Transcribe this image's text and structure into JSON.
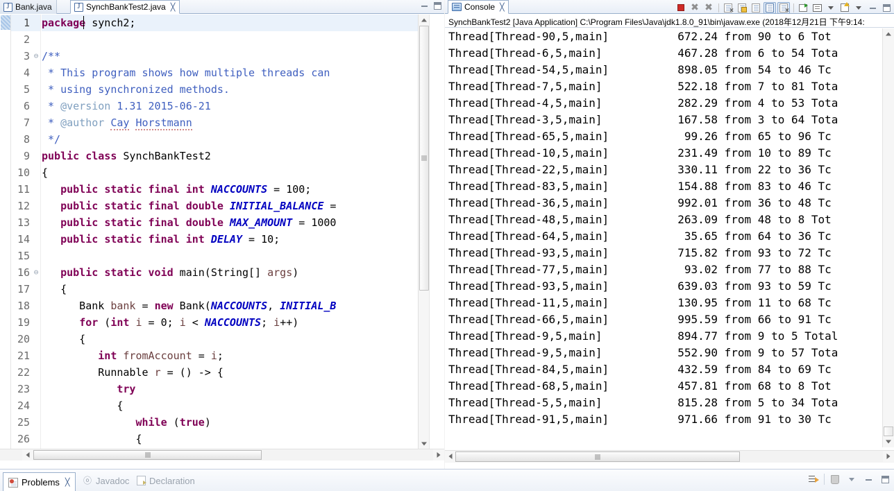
{
  "editor": {
    "tabs": [
      {
        "label": "Bank.java",
        "icon": "java-file-icon",
        "active": false,
        "closable": false
      },
      {
        "label": "SynchBankTest2.java",
        "icon": "java-file-icon",
        "active": true,
        "closable": true
      }
    ],
    "tab_minimize_label": "Minimize",
    "tab_maximize_label": "Maximize",
    "first_visible_line": 1,
    "lines": [
      {
        "n": "1",
        "fold": "",
        "html": "<span class=\"kw\">package</span> synch2;",
        "current": true
      },
      {
        "n": "2",
        "fold": "",
        "html": ""
      },
      {
        "n": "3",
        "fold": "⊖",
        "html": "<span class=\"cmt\">/**</span>"
      },
      {
        "n": "4",
        "fold": "",
        "html": "<span class=\"cmt\"> * This program shows how multiple threads can</span>"
      },
      {
        "n": "5",
        "fold": "",
        "html": "<span class=\"cmt\"> * using synchronized methods.</span>"
      },
      {
        "n": "6",
        "fold": "",
        "html": "<span class=\"cmt\"> * </span><span class=\"tag\">@version</span><span class=\"cmt\"> 1.31 2015-06-21</span>"
      },
      {
        "n": "7",
        "fold": "",
        "html": "<span class=\"cmt\"> * </span><span class=\"tag\">@author</span><span class=\"cmt\"> </span><span class=\"cmt sq\">Cay</span><span class=\"cmt\"> </span><span class=\"cmt sq\">Horstmann</span>"
      },
      {
        "n": "8",
        "fold": "",
        "html": "<span class=\"cmt\"> */</span>"
      },
      {
        "n": "9",
        "fold": "",
        "html": "<span class=\"kw\">public</span> <span class=\"kw\">class</span> SynchBankTest2"
      },
      {
        "n": "10",
        "fold": "",
        "html": "{"
      },
      {
        "n": "11",
        "fold": "",
        "html": "   <span class=\"kw\">public</span> <span class=\"kw\">static</span> <span class=\"kw\">final</span> <span class=\"kw\">int</span> <span class=\"field\">NACCOUNTS</span> = 100;"
      },
      {
        "n": "12",
        "fold": "",
        "html": "   <span class=\"kw\">public</span> <span class=\"kw\">static</span> <span class=\"kw\">final</span> <span class=\"kw\">double</span> <span class=\"field\">INITIAL_BALANCE</span> ="
      },
      {
        "n": "13",
        "fold": "",
        "html": "   <span class=\"kw\">public</span> <span class=\"kw\">static</span> <span class=\"kw\">final</span> <span class=\"kw\">double</span> <span class=\"field\">MAX_AMOUNT</span> = 1000"
      },
      {
        "n": "14",
        "fold": "",
        "html": "   <span class=\"kw\">public</span> <span class=\"kw\">static</span> <span class=\"kw\">final</span> <span class=\"kw\">int</span> <span class=\"field\">DELAY</span> = 10;"
      },
      {
        "n": "15",
        "fold": "",
        "html": ""
      },
      {
        "n": "16",
        "fold": "⊖",
        "html": "   <span class=\"kw\">public</span> <span class=\"kw\">static</span> <span class=\"kw\">void</span> main(String[] <span class=\"local\">args</span>)"
      },
      {
        "n": "17",
        "fold": "",
        "html": "   {"
      },
      {
        "n": "18",
        "fold": "",
        "html": "      Bank <span class=\"local\">bank</span> = <span class=\"kw\">new</span> Bank(<span class=\"field\">NACCOUNTS</span>, <span class=\"field\">INITIAL_B</span>"
      },
      {
        "n": "19",
        "fold": "",
        "html": "      <span class=\"kw\">for</span> (<span class=\"kw\">int</span> <span class=\"local\">i</span> = 0; <span class=\"local\">i</span> &lt; <span class=\"field\">NACCOUNTS</span>; <span class=\"local\">i</span>++)"
      },
      {
        "n": "20",
        "fold": "",
        "html": "      {"
      },
      {
        "n": "21",
        "fold": "",
        "html": "         <span class=\"kw\">int</span> <span class=\"local\">fromAccount</span> = <span class=\"local\">i</span>;"
      },
      {
        "n": "22",
        "fold": "",
        "html": "         Runnable <span class=\"local\">r</span> = () -&gt; {"
      },
      {
        "n": "23",
        "fold": "",
        "html": "            <span class=\"kw\">try</span>"
      },
      {
        "n": "24",
        "fold": "",
        "html": "            {"
      },
      {
        "n": "25",
        "fold": "",
        "html": "               <span class=\"kw\">while</span> (<span class=\"kw\">true</span>)"
      },
      {
        "n": "26",
        "fold": "",
        "html": "               {"
      }
    ]
  },
  "console": {
    "tab_label": "Console",
    "tab_icon": "console-icon",
    "toolbar": [
      {
        "name": "terminate-button",
        "label": "Terminate"
      },
      {
        "name": "remove-launch-button",
        "label": "Remove Launch"
      },
      {
        "name": "remove-all-terminated-button",
        "label": "Remove All Terminated Launches"
      },
      {
        "name": "clear-console-button",
        "label": "Clear Console"
      },
      {
        "name": "scroll-lock-button",
        "label": "Scroll Lock"
      },
      {
        "name": "word-wrap-button",
        "label": "Word Wrap"
      },
      {
        "name": "pin-console-button",
        "label": "Pin Console"
      },
      {
        "name": "display-selected-console-button",
        "label": "Display Selected Console"
      },
      {
        "name": "open-console-button",
        "label": "Open Console"
      },
      {
        "name": "minimize-button",
        "label": "Minimize"
      },
      {
        "name": "maximize-button",
        "label": "Maximize"
      }
    ],
    "launch_title": "SynchBankTest2 [Java Application] C:\\Program Files\\Java\\jdk1.8.0_91\\bin\\javaw.exe (2018年12月21日 下午9:14:",
    "lines": [
      {
        "thread": "Thread[Thread-90,5,main]",
        "amount": "672.24",
        "rest": "from 90 to 6 Tot"
      },
      {
        "thread": "Thread[Thread-6,5,main]",
        "amount": "467.28",
        "rest": "from 6 to 54 Tota"
      },
      {
        "thread": "Thread[Thread-54,5,main]",
        "amount": "898.05",
        "rest": "from 54 to 46 Tc"
      },
      {
        "thread": "Thread[Thread-7,5,main]",
        "amount": "522.18",
        "rest": "from 7 to 81 Tota"
      },
      {
        "thread": "Thread[Thread-4,5,main]",
        "amount": "282.29",
        "rest": "from 4 to 53 Tota"
      },
      {
        "thread": "Thread[Thread-3,5,main]",
        "amount": "167.58",
        "rest": "from 3 to 64 Tota"
      },
      {
        "thread": "Thread[Thread-65,5,main]",
        "amount": "99.26",
        "rest": "from 65 to 96 Tc"
      },
      {
        "thread": "Thread[Thread-10,5,main]",
        "amount": "231.49",
        "rest": "from 10 to 89 Tc"
      },
      {
        "thread": "Thread[Thread-22,5,main]",
        "amount": "330.11",
        "rest": "from 22 to 36 Tc"
      },
      {
        "thread": "Thread[Thread-83,5,main]",
        "amount": "154.88",
        "rest": "from 83 to 46 Tc"
      },
      {
        "thread": "Thread[Thread-36,5,main]",
        "amount": "992.01",
        "rest": "from 36 to 48 Tc"
      },
      {
        "thread": "Thread[Thread-48,5,main]",
        "amount": "263.09",
        "rest": "from 48 to 8 Tot"
      },
      {
        "thread": "Thread[Thread-64,5,main]",
        "amount": "35.65",
        "rest": "from 64 to 36 Tc"
      },
      {
        "thread": "Thread[Thread-93,5,main]",
        "amount": "715.82",
        "rest": "from 93 to 72 Tc"
      },
      {
        "thread": "Thread[Thread-77,5,main]",
        "amount": "93.02",
        "rest": "from 77 to 88 Tc"
      },
      {
        "thread": "Thread[Thread-93,5,main]",
        "amount": "639.03",
        "rest": "from 93 to 59 Tc"
      },
      {
        "thread": "Thread[Thread-11,5,main]",
        "amount": "130.95",
        "rest": "from 11 to 68 Tc"
      },
      {
        "thread": "Thread[Thread-66,5,main]",
        "amount": "995.59",
        "rest": "from 66 to 91 Tc"
      },
      {
        "thread": "Thread[Thread-9,5,main]",
        "amount": "894.77",
        "rest": "from 9 to 5 Total"
      },
      {
        "thread": "Thread[Thread-9,5,main]",
        "amount": "552.90",
        "rest": "from 9 to 57 Tota"
      },
      {
        "thread": "Thread[Thread-84,5,main]",
        "amount": "432.59",
        "rest": "from 84 to 69 Tc"
      },
      {
        "thread": "Thread[Thread-68,5,main]",
        "amount": "457.81",
        "rest": "from 68 to 8 Tot"
      },
      {
        "thread": "Thread[Thread-5,5,main]",
        "amount": "815.28",
        "rest": "from 5 to 34 Tota"
      },
      {
        "thread": "Thread[Thread-91,5,main]",
        "amount": "971.66",
        "rest": "from 91 to 30 Tc"
      }
    ]
  },
  "bottom_views": {
    "tabs": [
      {
        "label": "Problems",
        "icon": "problems-icon",
        "active": true,
        "closable": true
      },
      {
        "label": "Javadoc",
        "icon": "javadoc-icon",
        "active": false,
        "closable": false
      },
      {
        "label": "Declaration",
        "icon": "declaration-icon",
        "active": false,
        "closable": false
      }
    ],
    "actions": [
      {
        "name": "filters-button",
        "label": "Filters"
      },
      {
        "name": "trash-button",
        "label": "Delete"
      },
      {
        "name": "view-menu-button",
        "label": "View Menu"
      },
      {
        "name": "minimize-button",
        "label": "Minimize"
      },
      {
        "name": "maximize-button",
        "label": "Maximize"
      }
    ]
  },
  "colors": {
    "keyword": "#7f0055",
    "comment": "#3f5fbf",
    "javadoc_tag": "#7f9fbf",
    "static_field": "#0000c0",
    "local_var": "#6a3e3e",
    "current_line": "#eaf2fb",
    "tab_border": "#9ab0cc"
  }
}
